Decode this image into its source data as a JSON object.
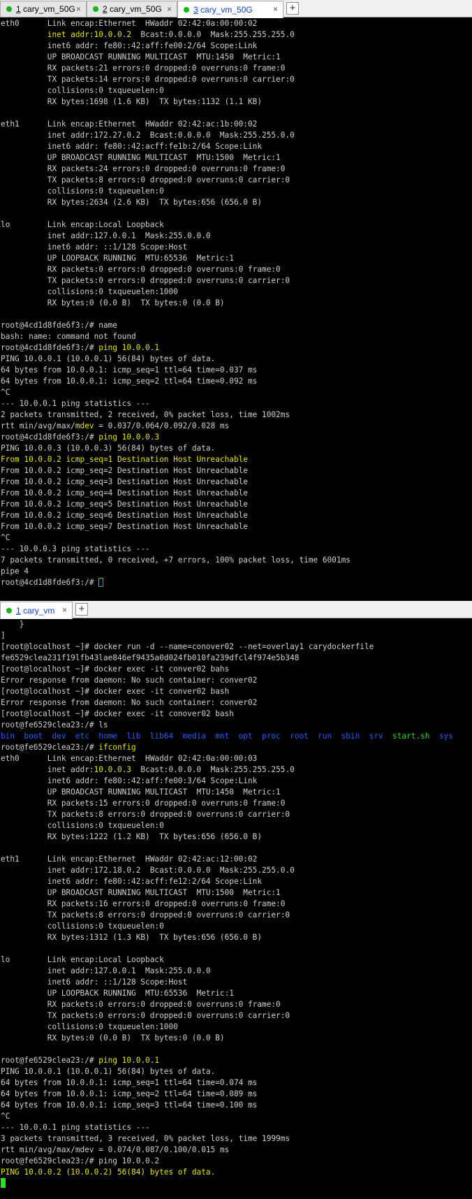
{
  "top_tabs": [
    {
      "num": "1",
      "label": " cary_vm_50G",
      "active": false
    },
    {
      "num": "2",
      "label": " cary_vm_50G",
      "active": false
    },
    {
      "num": "3",
      "label": " cary_vm_50G",
      "active": true
    }
  ],
  "bottom_tabs": [
    {
      "num": "1",
      "label": " cary_vm",
      "active": true
    }
  ],
  "close_glyph": "×",
  "add_glyph": "+",
  "colors": {
    "prompt_yellow": "#e6e600",
    "dir_blue": "#2a5cff",
    "exec_green": "#22d822",
    "text": "#cfcfcf",
    "bg": "#000000"
  },
  "top_terminal": [
    [
      {
        "t": "eth0      Link encap:Ethernet  HWaddr 02:42:0a:00:00:02"
      }
    ],
    [
      {
        "t": "          "
      },
      {
        "t": "inet addr:10.0.0.2",
        "c": "y"
      },
      {
        "t": "  Bcast:0.0.0.0  Mask:255.255.255.0"
      }
    ],
    [
      {
        "t": "          inet6 addr: fe80::42:aff:fe00:2/64 Scope:Link"
      }
    ],
    [
      {
        "t": "          UP BROADCAST RUNNING MULTICAST  MTU:1450  Metric:1"
      }
    ],
    [
      {
        "t": "          RX packets:21 errors:0 dropped:0 overruns:0 frame:0"
      }
    ],
    [
      {
        "t": "          TX packets:14 errors:0 dropped:0 overruns:0 carrier:0"
      }
    ],
    [
      {
        "t": "          collisions:0 txqueuelen:0"
      }
    ],
    [
      {
        "t": "          RX bytes:1698 (1.6 KB)  TX bytes:1132 (1.1 KB)"
      }
    ],
    [
      {
        "t": ""
      }
    ],
    [
      {
        "t": "eth1      Link encap:Ethernet  HWaddr 02:42:ac:1b:00:02"
      }
    ],
    [
      {
        "t": "          inet addr:172.27.0.2  Bcast:0.0.0.0  Mask:255.255.0.0"
      }
    ],
    [
      {
        "t": "          inet6 addr: fe80::42:acff:fe1b:2/64 Scope:Link"
      }
    ],
    [
      {
        "t": "          UP BROADCAST RUNNING MULTICAST  MTU:1500  Metric:1"
      }
    ],
    [
      {
        "t": "          RX packets:24 errors:0 dropped:0 overruns:0 frame:0"
      }
    ],
    [
      {
        "t": "          TX packets:8 errors:0 dropped:0 overruns:0 carrier:0"
      }
    ],
    [
      {
        "t": "          collisions:0 txqueuelen:0"
      }
    ],
    [
      {
        "t": "          RX bytes:2634 (2.6 KB)  TX bytes:656 (656.0 B)"
      }
    ],
    [
      {
        "t": ""
      }
    ],
    [
      {
        "t": "lo        Link encap:Local Loopback"
      }
    ],
    [
      {
        "t": "          inet addr:127.0.0.1  Mask:255.0.0.0"
      }
    ],
    [
      {
        "t": "          inet6 addr: ::1/128 Scope:Host"
      }
    ],
    [
      {
        "t": "          UP LOOPBACK RUNNING  MTU:65536  Metric:1"
      }
    ],
    [
      {
        "t": "          RX packets:0 errors:0 dropped:0 overruns:0 frame:0"
      }
    ],
    [
      {
        "t": "          TX packets:0 errors:0 dropped:0 overruns:0 carrier:0"
      }
    ],
    [
      {
        "t": "          collisions:0 txqueuelen:1000"
      }
    ],
    [
      {
        "t": "          RX bytes:0 (0.0 B)  TX bytes:0 (0.0 B)"
      }
    ],
    [
      {
        "t": ""
      }
    ],
    [
      {
        "t": "root@4cd1d8fde6f3:/# name"
      }
    ],
    [
      {
        "t": "bash: name: command not found"
      }
    ],
    [
      {
        "t": "root@4cd1d8fde6f3:/# "
      },
      {
        "t": "ping 10.0.0.1",
        "c": "y"
      }
    ],
    [
      {
        "t": "PING 10.0.0.1 (10.0.0.1) 56(84) bytes of data."
      }
    ],
    [
      {
        "t": "64 bytes from 10.0.0.1: icmp_seq=1 ttl=64 time=0.037 ms"
      }
    ],
    [
      {
        "t": "64 bytes from 10.0.0.1: icmp_seq=2 ttl=64 time=0.092 ms"
      }
    ],
    [
      {
        "t": "^C"
      }
    ],
    [
      {
        "t": "--- 10.0.0.1 ping statistics ---"
      }
    ],
    [
      {
        "t": "2 packets transmitted, 2 received, 0% packet loss, time 1002ms"
      }
    ],
    [
      {
        "t": "rtt min/avg/max/"
      },
      {
        "t": "mdev",
        "c": "y"
      },
      {
        "t": " = 0.037/0.064/0.092/0.028 ms"
      }
    ],
    [
      {
        "t": "root@4cd1d8fde6f3:/# "
      },
      {
        "t": "ping 10.0.0.3",
        "c": "y"
      }
    ],
    [
      {
        "t": "PING 10.0.0.3 (10.0.0.3) 56(84) bytes of data."
      }
    ],
    [
      {
        "t": "From 10.0.0.2 icmp_seq=1 Destination Host Unreachable",
        "c": "y"
      }
    ],
    [
      {
        "t": "From 10.0.0.2 icmp_seq=2 Destination Host Unreachable"
      }
    ],
    [
      {
        "t": "From 10.0.0.2 icmp_seq=3 Destination Host Unreachable"
      }
    ],
    [
      {
        "t": "From 10.0.0.2 icmp_seq=4 Destination Host Unreachable"
      }
    ],
    [
      {
        "t": "From 10.0.0.2 icmp_seq=5 Destination Host Unreachable"
      }
    ],
    [
      {
        "t": "From 10.0.0.2 icmp_seq=6 Destination Host Unreachable"
      }
    ],
    [
      {
        "t": "From 10.0.0.2 icmp_seq=7 Destination Host Unreachable"
      }
    ],
    [
      {
        "t": "^C"
      }
    ],
    [
      {
        "t": "--- 10.0.0.3 ping statistics ---"
      }
    ],
    [
      {
        "t": "7 packets transmitted, 0 received, +7 errors, 100% packet loss, time 6001ms"
      }
    ],
    [
      {
        "t": "pipe 4"
      }
    ],
    [
      {
        "t": "root@4cd1d8fde6f3:/# "
      },
      {
        "cursor": "outline"
      }
    ]
  ],
  "bottom_terminal": [
    [
      {
        "t": "    }"
      }
    ],
    [
      {
        "t": "]"
      }
    ],
    [
      {
        "t": "[root@localhost ~]# docker run -d --name=conover02 --net=overlay1 carydockerfile"
      }
    ],
    [
      {
        "t": "fe6529clea231f19lfb43lae846ef9435a0d024fb010fa239dfcl4f974e5b348"
      }
    ],
    [
      {
        "t": "[root@localhost ~]# docker exec -it conver02 bahs"
      }
    ],
    [
      {
        "t": "Error response from daemon: No such container: conver02"
      }
    ],
    [
      {
        "t": "[root@localhost ~]# docker exec -it conver02 bash"
      }
    ],
    [
      {
        "t": "Error response from daemon: No such container: conver02"
      }
    ],
    [
      {
        "t": "[root@localhost ~]# docker exec -it conover02 bash"
      }
    ],
    [
      {
        "t": "root@fe6529clea23:/# ls"
      }
    ],
    [
      {
        "t": "bin  boot  dev  etc  home  lib  lib64  media  mnt  opt  proc  root  run  sbin  srv  ",
        "c": "b"
      },
      {
        "t": "start.sh",
        "c": "g"
      },
      {
        "t": "  sys",
        "c": "b"
      }
    ],
    [
      {
        "t": "root@fe6529clea23:/# "
      },
      {
        "t": "ifconfig",
        "c": "y"
      }
    ],
    [
      {
        "t": "eth0      Link encap:Ethernet  HWaddr 02:42:0a:00:00:03"
      }
    ],
    [
      {
        "t": "          inet addr:"
      },
      {
        "t": "10.0.0.3",
        "c": "y"
      },
      {
        "t": "  Bcast:0.0.0.0  Mask:255.255.255.0"
      }
    ],
    [
      {
        "t": "          inet6 addr: fe80::42:aff:fe00:3/64 Scope:Link"
      }
    ],
    [
      {
        "t": "          UP BROADCAST RUNNING MULTICAST  MTU:1450  Metric:1"
      }
    ],
    [
      {
        "t": "          RX packets:15 errors:0 dropped:0 overruns:0 frame:0"
      }
    ],
    [
      {
        "t": "          TX packets:8 errors:0 dropped:0 overruns:0 carrier:0"
      }
    ],
    [
      {
        "t": "          collisions:0 txqueuelen:0"
      }
    ],
    [
      {
        "t": "          RX bytes:1222 (1.2 KB)  TX bytes:656 (656.0 B)"
      }
    ],
    [
      {
        "t": ""
      }
    ],
    [
      {
        "t": "eth1      Link encap:Ethernet  HWaddr 02:42:ac:12:00:02"
      }
    ],
    [
      {
        "t": "          inet addr:172.18.0.2  Bcast:0.0.0.0  Mask:255.255.0.0"
      }
    ],
    [
      {
        "t": "          inet6 addr: fe80::42:acff:fe12:2/64 Scope:Link"
      }
    ],
    [
      {
        "t": "          UP BROADCAST RUNNING MULTICAST  MTU:1500  Metric:1"
      }
    ],
    [
      {
        "t": "          RX packets:16 errors:0 dropped:0 overruns:0 frame:0"
      }
    ],
    [
      {
        "t": "          TX packets:8 errors:0 dropped:0 overruns:0 carrier:0"
      }
    ],
    [
      {
        "t": "          collisions:0 txqueuelen:0"
      }
    ],
    [
      {
        "t": "          RX bytes:1312 (1.3 KB)  TX bytes:656 (656.0 B)"
      }
    ],
    [
      {
        "t": ""
      }
    ],
    [
      {
        "t": "lo        Link encap:Local Loopback"
      }
    ],
    [
      {
        "t": "          inet addr:127.0.0.1  Mask:255.0.0.0"
      }
    ],
    [
      {
        "t": "          inet6 addr: ::1/128 Scope:Host"
      }
    ],
    [
      {
        "t": "          UP LOOPBACK RUNNING  MTU:65536  Metric:1"
      }
    ],
    [
      {
        "t": "          RX packets:0 errors:0 dropped:0 overruns:0 frame:0"
      }
    ],
    [
      {
        "t": "          TX packets:0 errors:0 dropped:0 overruns:0 carrier:0"
      }
    ],
    [
      {
        "t": "          collisions:0 txqueuelen:1000"
      }
    ],
    [
      {
        "t": "          RX bytes:0 (0.0 B)  TX bytes:0 (0.0 B)"
      }
    ],
    [
      {
        "t": ""
      }
    ],
    [
      {
        "t": "root@fe6529clea23:/# "
      },
      {
        "t": "ping 10.0.0.1",
        "c": "y"
      }
    ],
    [
      {
        "t": "PING 10.0.0.1 (10.0.0.1) 56(84) bytes of data."
      }
    ],
    [
      {
        "t": "64 bytes from 10.0.0.1: icmp_seq=1 ttl=64 time=0.074 ms"
      }
    ],
    [
      {
        "t": "64 bytes from 10.0.0.1: icmp_seq=2 ttl=64 time=0.089 ms"
      }
    ],
    [
      {
        "t": "64 bytes from 10.0.0.1: icmp_seq=3 ttl=64 time=0.100 ms"
      }
    ],
    [
      {
        "t": "^C"
      }
    ],
    [
      {
        "t": "--- 10.0.0.1 ping statistics ---"
      }
    ],
    [
      {
        "t": "3 packets transmitted, 3 received, 0% packet loss, time 1999ms"
      }
    ],
    [
      {
        "t": "rtt min/avg/max/mdev = 0.074/0.087/0.100/0.015 ms"
      }
    ],
    [
      {
        "t": "root@fe6529clea23:/# ping 10.0.0.2"
      }
    ],
    [
      {
        "t": "PING 10.0.0.2 (10.0.0.2) 56(84) bytes of data.",
        "c": "y"
      }
    ],
    [
      {
        "cursor": "block"
      }
    ]
  ]
}
